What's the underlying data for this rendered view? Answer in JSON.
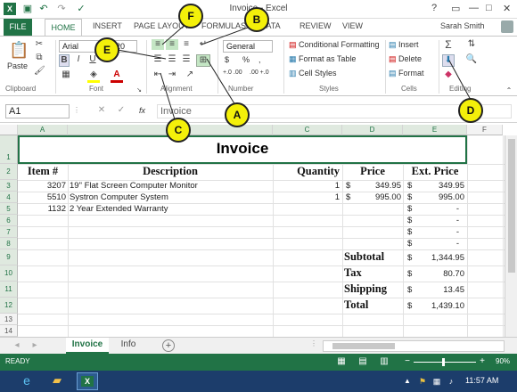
{
  "window": {
    "title": "Invoice - Excel",
    "user": "Sarah Smith",
    "help": "?",
    "minimize": "—",
    "restore": "□",
    "close": "✕"
  },
  "ribbon_tabs": [
    "FILE",
    "HOME",
    "INSERT",
    "PAGE LAYOUT",
    "FORMULAS",
    "DATA",
    "REVIEW",
    "VIEW"
  ],
  "clipboard": {
    "paste": "Paste",
    "label": "Clipboard"
  },
  "font": {
    "name": "Arial",
    "size": "20",
    "bold": "B",
    "italic": "I",
    "underline": "U",
    "label": "Font"
  },
  "alignment": {
    "label": "Alignment"
  },
  "number": {
    "format": "General",
    "currency": "$",
    "percent": "%",
    "comma": ",",
    "inc_dec": "+.0 .00",
    "dec_dec": ".00 +.0",
    "label": "Number"
  },
  "styles": {
    "cond": "Conditional Formatting",
    "table": "Format as Table",
    "cell": "Cell Styles",
    "label": "Styles"
  },
  "cells": {
    "insert": "Insert",
    "delete": "Delete",
    "format": "Format",
    "label": "Cells"
  },
  "editing": {
    "label": "Editing"
  },
  "formula_bar": {
    "name_box": "A1",
    "fx": "fx",
    "value": "Invoice"
  },
  "columns": [
    "A",
    "B",
    "C",
    "D",
    "E",
    "F"
  ],
  "rows": [
    "1",
    "2",
    "3",
    "4",
    "5",
    "6",
    "7",
    "8",
    "9",
    "10",
    "11",
    "12",
    "13",
    "14"
  ],
  "invoice": {
    "title": "Invoice",
    "headers": {
      "item": "Item #",
      "desc": "Description",
      "qty": "Quantity",
      "price": "Price",
      "ext": "Ext. Price"
    },
    "lines": [
      {
        "item": "3207",
        "desc": "19\" Flat Screen Computer Monitor",
        "qty": "1",
        "cur1": "$",
        "price": "349.95",
        "cur2": "$",
        "ext": "349.95"
      },
      {
        "item": "5510",
        "desc": "Systron Computer System",
        "qty": "1",
        "cur1": "$",
        "price": "995.00",
        "cur2": "$",
        "ext": "995.00"
      },
      {
        "item": "1132",
        "desc": "2 Year Extended Warranty",
        "qty": "",
        "cur1": "",
        "price": "",
        "cur2": "$",
        "ext": "-"
      },
      {
        "item": "",
        "desc": "",
        "qty": "",
        "cur1": "",
        "price": "",
        "cur2": "$",
        "ext": "-"
      },
      {
        "item": "",
        "desc": "",
        "qty": "",
        "cur1": "",
        "price": "",
        "cur2": "$",
        "ext": "-"
      },
      {
        "item": "",
        "desc": "",
        "qty": "",
        "cur1": "",
        "price": "",
        "cur2": "$",
        "ext": "-"
      }
    ],
    "totals": [
      {
        "label": "Subtotal",
        "cur": "$",
        "value": "1,344.95"
      },
      {
        "label": "Tax",
        "cur": "$",
        "value": "80.70"
      },
      {
        "label": "Shipping",
        "cur": "$",
        "value": "13.45"
      },
      {
        "label": "Total",
        "cur": "$",
        "value": "1,439.10"
      }
    ]
  },
  "sheet_tabs": [
    "Invoice",
    "Info"
  ],
  "status": {
    "ready": "READY",
    "zoom": "90%"
  },
  "taskbar": {
    "time": "11:57 AM"
  },
  "callouts": [
    "A",
    "B",
    "C",
    "D",
    "E",
    "F"
  ],
  "colors": {
    "excel_green": "#217346",
    "callout_yellow": "#f4f00a",
    "taskbar": "#1c3d6b"
  }
}
